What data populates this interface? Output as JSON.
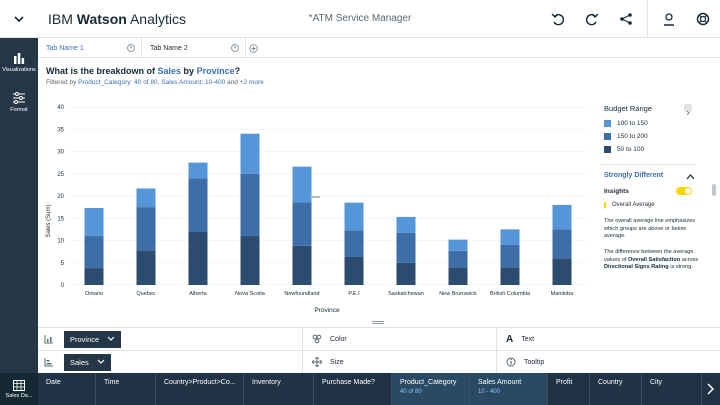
{
  "app": {
    "brand_light": "IBM ",
    "brand_bold": "Watson",
    "brand_rest": " Analytics",
    "doc_title": "*ATM Service Manager"
  },
  "rail": {
    "items": [
      {
        "label": "Visualizations",
        "icon": "bar-chart-icon"
      },
      {
        "label": "Format",
        "icon": "sliders-icon"
      }
    ]
  },
  "tabs": [
    {
      "label": "Tab Name 1",
      "active": true
    },
    {
      "label": "Tab Name 2",
      "active": false
    }
  ],
  "question": {
    "p1": "What is the breakdown of ",
    "measure": "Sales",
    "p2": " by ",
    "dimension": "Province",
    "p3": "?"
  },
  "filter": {
    "prefix": "Filtered by ",
    "f1": "Product_Category: 40 of 80",
    "sep": ", ",
    "f2": "Sales Amount: 10-400",
    "and": " and ",
    "more": "+2 more"
  },
  "chart_data": {
    "type": "bar",
    "stacked": true,
    "xlabel": "Province",
    "ylabel": "Sales (Sum)",
    "ylim": [
      0,
      40
    ],
    "yticks": [
      0,
      5,
      10,
      15,
      20,
      25,
      30,
      35,
      40
    ],
    "categories": [
      "Ontario",
      "Quebec",
      "Alberta",
      "Nova Scotia",
      "Newfoundland",
      "P.E.I",
      "Saskatchewan",
      "New Brunswick",
      "British Columbia",
      "Manitoba"
    ],
    "series": [
      {
        "name": "50 to 100",
        "color": "#2b4c6f",
        "values": [
          3.8,
          7.8,
          12.0,
          11.0,
          8.8,
          6.3,
          5.0,
          4.0,
          4.0,
          6.0
        ]
      },
      {
        "name": "150 to 200",
        "color": "#3e6ea8",
        "values": [
          7.2,
          9.7,
          12.0,
          14.0,
          9.8,
          6.0,
          6.7,
          3.7,
          5.0,
          6.5
        ]
      },
      {
        "name": "100 to 150",
        "color": "#5596d8",
        "values": [
          6.3,
          4.2,
          3.5,
          9.0,
          8.0,
          6.2,
          3.6,
          2.5,
          3.5,
          5.5
        ]
      }
    ],
    "grid": true,
    "legend": "right"
  },
  "legend": {
    "title": "Budget Range",
    "items": [
      {
        "label": "100 to 150",
        "color": "#5596d8"
      },
      {
        "label": "150 to 200",
        "color": "#3e6ea8"
      },
      {
        "label": "50 to 100",
        "color": "#2b4c6f"
      }
    ]
  },
  "insights": {
    "section_title": "Strongly Different",
    "label": "Insights",
    "overall": "Overall Average",
    "desc1": "The overall average line emphasizes which groups are above or below average.",
    "desc2_a": "The difference between the average values of ",
    "desc2_b": "Overall Satisfaction",
    "desc2_c": " across ",
    "desc2_d": "Directional Signs Rating",
    "desc2_e": " is strong."
  },
  "fields": {
    "x_axis": "Province",
    "y_axis": "Sales",
    "color": "Color",
    "size": "Size",
    "text": "Text",
    "tooltip": "Tooltip"
  },
  "bottom": {
    "left_label": "Sales Da...",
    "columns": [
      {
        "label": "Date",
        "sub": ""
      },
      {
        "label": "Time",
        "sub": ""
      },
      {
        "label": "Country>Product>Co...",
        "sub": ""
      },
      {
        "label": "Inventory",
        "sub": ""
      },
      {
        "label": "Purchase Made?",
        "sub": ""
      },
      {
        "label": "Product_Category",
        "sub": "40 of 80",
        "active": true
      },
      {
        "label": "Sales Amount",
        "sub": "10 - 400",
        "active": true
      },
      {
        "label": "Profit",
        "sub": ""
      },
      {
        "label": "Country",
        "sub": ""
      },
      {
        "label": "City",
        "sub": ""
      }
    ]
  }
}
